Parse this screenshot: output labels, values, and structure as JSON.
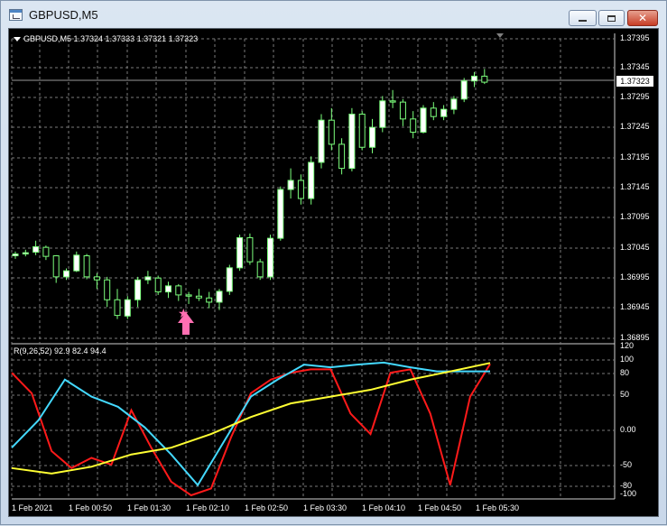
{
  "window": {
    "title": "GBPUSD,M5",
    "minimize_icon": "minimize-icon",
    "maximize_icon": "maximize-icon",
    "close_icon": "close-icon"
  },
  "chart": {
    "header": "GBPUSD,M5  1.37324 1.37333 1.37321 1.37323",
    "current_price": "1.37323",
    "price_axis": [
      "1.37395",
      "1.37345",
      "1.37295",
      "1.37245",
      "1.37195",
      "1.37145",
      "1.37095",
      "1.37045",
      "1.36995",
      "1.36945",
      "1.36895"
    ],
    "indicator_header": "R(9,26,52) 92.9 82.4 94.4",
    "indicator_axis": [
      "120",
      "100",
      "80",
      "50",
      "0.00",
      "-50",
      "-80",
      "-100"
    ],
    "time_axis": [
      "1 Feb 2021",
      "1 Feb 00:50",
      "1 Feb 01:30",
      "1 Feb 02:10",
      "1 Feb 02:50",
      "1 Feb 03:30",
      "1 Feb 04:10",
      "1 Feb 04:50",
      "1 Feb 05:30"
    ],
    "markers": [
      {
        "name": "star-marker",
        "color": "#ff6fb2",
        "icon": "star-icon"
      },
      {
        "name": "up-arrow-marker",
        "color": "#ff6fb2",
        "icon": "arrow-up-icon"
      }
    ],
    "colors": {
      "bull_candle": "#ffffff",
      "bear_candle": "#000000",
      "candle_outline": "#7cff7c",
      "grid": "#7a7a7a",
      "line_red": "#ff1a1a",
      "line_cyan": "#44d9ff",
      "line_yellow": "#ffff33"
    }
  },
  "chart_data": [
    {
      "type": "candlestick",
      "title": "GBPUSD,M5",
      "ohlc_header": [
        "1.37324",
        "1.37333",
        "1.37321",
        "1.37323"
      ],
      "x": [
        "1 Feb 2021",
        "1 Feb 00:50",
        "1 Feb 01:30",
        "1 Feb 02:10",
        "1 Feb 02:50",
        "1 Feb 03:30",
        "1 Feb 04:10",
        "1 Feb 04:50",
        "1 Feb 05:30"
      ],
      "ylim": [
        1.36895,
        1.37395
      ],
      "grid": true,
      "series": [
        {
          "values": [
            [
              1.37035,
              1.37042,
              1.3703,
              1.37038
            ],
            [
              1.37038,
              1.37045,
              1.37034,
              1.3704
            ],
            [
              1.37041,
              1.3706,
              1.37036,
              1.3705
            ],
            [
              1.37049,
              1.37052,
              1.37028,
              1.37034
            ],
            [
              1.37035,
              1.37036,
              1.3699,
              1.37
            ],
            [
              1.37,
              1.37014,
              1.36995,
              1.3701
            ],
            [
              1.3701,
              1.37042,
              1.37008,
              1.37036
            ],
            [
              1.37035,
              1.37038,
              1.36996,
              1.37
            ],
            [
              1.37,
              1.37006,
              1.3698,
              1.36995
            ],
            [
              1.36995,
              1.37,
              1.3695,
              1.36962
            ],
            [
              1.36962,
              1.3698,
              1.3693,
              1.36936
            ],
            [
              1.36935,
              1.36968,
              1.3693,
              1.36962
            ],
            [
              1.36962,
              1.37,
              1.3695,
              1.36995
            ],
            [
              1.36995,
              1.3701,
              1.36988,
              1.37
            ],
            [
              1.36998,
              1.37002,
              1.3697,
              1.36975
            ],
            [
              1.36975,
              1.36992,
              1.36965,
              1.36985
            ],
            [
              1.36985,
              1.36988,
              1.3696,
              1.3697
            ],
            [
              1.3697,
              1.36975,
              1.36955,
              1.36968
            ],
            [
              1.36968,
              1.3698,
              1.3696,
              1.36965
            ],
            [
              1.36965,
              1.36975,
              1.36948,
              1.36958
            ],
            [
              1.36958,
              1.3698,
              1.36945,
              1.36976
            ],
            [
              1.36976,
              1.3702,
              1.3697,
              1.37015
            ],
            [
              1.37015,
              1.3707,
              1.3701,
              1.37065
            ],
            [
              1.37065,
              1.37072,
              1.3702,
              1.37025
            ],
            [
              1.37025,
              1.3703,
              1.36995,
              1.37
            ],
            [
              1.37,
              1.3707,
              1.36995,
              1.37064
            ],
            [
              1.37064,
              1.3715,
              1.3706,
              1.37145
            ],
            [
              1.37145,
              1.3718,
              1.3713,
              1.3716
            ],
            [
              1.3716,
              1.3717,
              1.3712,
              1.3713
            ],
            [
              1.3713,
              1.372,
              1.3712,
              1.3719
            ],
            [
              1.3719,
              1.3727,
              1.3718,
              1.3726
            ],
            [
              1.3726,
              1.3728,
              1.3721,
              1.3722
            ],
            [
              1.3722,
              1.3723,
              1.3717,
              1.3718
            ],
            [
              1.3718,
              1.3728,
              1.37175,
              1.3727
            ],
            [
              1.3727,
              1.37275,
              1.3721,
              1.37215
            ],
            [
              1.37215,
              1.37262,
              1.37205,
              1.37248
            ],
            [
              1.37248,
              1.373,
              1.3724,
              1.37292
            ],
            [
              1.37292,
              1.3731,
              1.3728,
              1.3729
            ],
            [
              1.3729,
              1.37295,
              1.3725,
              1.37262
            ],
            [
              1.37262,
              1.37275,
              1.3723,
              1.3724
            ],
            [
              1.3724,
              1.37285,
              1.37238,
              1.3728
            ],
            [
              1.3728,
              1.3729,
              1.3726,
              1.37266
            ],
            [
              1.37266,
              1.37285,
              1.3726,
              1.37278
            ],
            [
              1.37278,
              1.373,
              1.3727,
              1.37295
            ],
            [
              1.37295,
              1.3733,
              1.3729,
              1.37325
            ],
            [
              1.37325,
              1.3734,
              1.37315,
              1.37333
            ],
            [
              1.37333,
              1.37345,
              1.3732,
              1.37323
            ]
          ]
        }
      ]
    },
    {
      "type": "line",
      "title": "R(9,26,52)",
      "x": [
        "1 Feb 2021",
        "1 Feb 00:50",
        "1 Feb 01:30",
        "1 Feb 02:10",
        "1 Feb 02:50",
        "1 Feb 03:30",
        "1 Feb 04:10",
        "1 Feb 04:50",
        "1 Feb 05:30"
      ],
      "ylim": [
        -100,
        120
      ],
      "grid": true,
      "series": [
        {
          "name": "9",
          "color": "#ff1a1a",
          "values": [
            80,
            50,
            -35,
            -60,
            -45,
            -55,
            25,
            -30,
            -80,
            -100,
            -90,
            -15,
            50,
            70,
            80,
            85,
            85,
            20,
            -10,
            80,
            85,
            20,
            -85,
            45,
            92.9
          ]
        },
        {
          "name": "26",
          "color": "#44d9ff",
          "values": [
            -30,
            10,
            70,
            45,
            30,
            0,
            -40,
            -85,
            -20,
            45,
            70,
            92,
            88,
            92,
            95,
            88,
            82,
            82,
            82
          ]
        },
        {
          "name": "52",
          "color": "#ffff33",
          "values": [
            -60,
            -68,
            -58,
            -40,
            -30,
            -10,
            15,
            35,
            45,
            55,
            70,
            82,
            94.4
          ]
        }
      ]
    }
  ]
}
